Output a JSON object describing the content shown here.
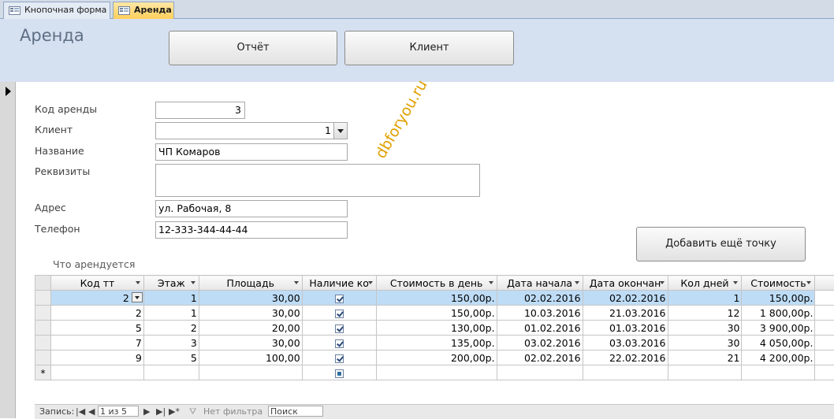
{
  "tabs": [
    {
      "label": "Кнопочная форма",
      "icon": "form-icon"
    },
    {
      "label": "Аренда",
      "icon": "form-icon"
    }
  ],
  "header": {
    "title": "Аренда",
    "report_button": "Отчёт",
    "client_button": "Клиент"
  },
  "form": {
    "code_label": "Код аренды",
    "code_value": "3",
    "client_label": "Клиент",
    "client_value": "1",
    "name_label": "Название",
    "name_value": "ЧП Комаров",
    "details_label": "Реквизиты",
    "details_value": "",
    "address_label": "Адрес",
    "address_value": "ул. Рабочая, 8",
    "phone_label": "Телефон",
    "phone_value": "12-333-344-44-44",
    "add_point_button": "Добавить ещё точку"
  },
  "watermark": "dbforyou.ru",
  "subform": {
    "label": "Что арендуется",
    "columns": [
      "Код тт",
      "Этаж",
      "Площадь",
      "Наличие ко",
      "Стоимость в день",
      "Дата начала",
      "Дата окончан",
      "Кол дней",
      "Стоимость"
    ],
    "rows": [
      {
        "code": "2",
        "floor": "1",
        "area": "30,00",
        "check": true,
        "price_day": "150,00р.",
        "start": "02.02.2016",
        "end": "02.02.2016",
        "days": "1",
        "cost": "150,00р."
      },
      {
        "code": "2",
        "floor": "1",
        "area": "30,00",
        "check": true,
        "price_day": "150,00р.",
        "start": "10.03.2016",
        "end": "21.03.2016",
        "days": "12",
        "cost": "1 800,00р."
      },
      {
        "code": "5",
        "floor": "2",
        "area": "20,00",
        "check": true,
        "price_day": "130,00р.",
        "start": "01.02.2016",
        "end": "01.03.2016",
        "days": "30",
        "cost": "3 900,00р."
      },
      {
        "code": "7",
        "floor": "3",
        "area": "30,00",
        "check": true,
        "price_day": "135,00р.",
        "start": "03.02.2016",
        "end": "03.03.2016",
        "days": "30",
        "cost": "4 050,00р."
      },
      {
        "code": "9",
        "floor": "5",
        "area": "100,00",
        "check": true,
        "price_day": "200,00р.",
        "start": "02.02.2016",
        "end": "22.02.2016",
        "days": "21",
        "cost": "4 200,00р."
      }
    ],
    "new_row_marker": "*"
  },
  "navigator": {
    "label": "Запись:",
    "position": "1 из 5",
    "filter": "Нет фильтра",
    "search_placeholder": "Поиск"
  }
}
